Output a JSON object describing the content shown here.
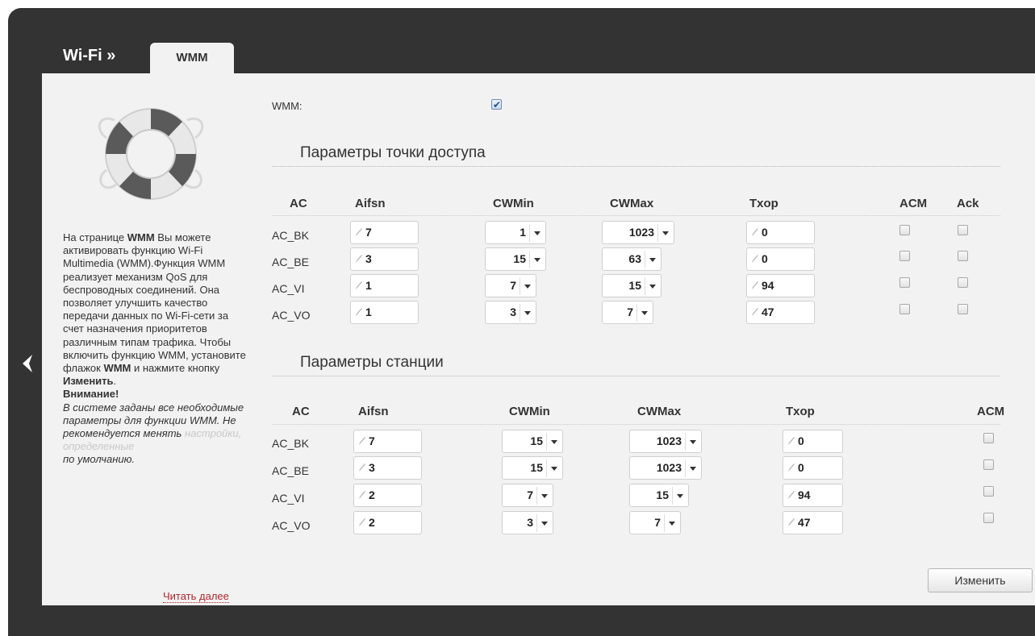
{
  "breadcrumb": {
    "root": "Wi-Fi »",
    "tab": "WMM"
  },
  "help": {
    "p1_a": "На странице ",
    "p1_b": "WMM",
    "p1_c": " Вы можете активировать функцию Wi-Fi Multimedia (WMM).Функция WMM реализует механизм QoS для беспроводных соединений. Она позволяет улучшить качество передачи данных по Wi-Fi-сети за счет назначения приоритетов различным типам трафика. Чтобы включить функцию WMM, установите флажок ",
    "p1_d": "WMM",
    "p1_e": " и нажмите кнопку ",
    "p1_f": "Изменить",
    "p1_g": ".",
    "warn": "Внимание!",
    "italic": "В системе заданы все необходимые параметры для функции WMM. Не рекомендуется менять ",
    "faded": "настройки, определенные",
    "tail": "по умолчанию.",
    "more": "Читать далее"
  },
  "wmm": {
    "label": "WMM:",
    "checked": true
  },
  "ap": {
    "title": "Параметры точки доступа",
    "headers": {
      "ac": "AC",
      "aifsn": "Aifsn",
      "cwmin": "CWMin",
      "cwmax": "CWMax",
      "txop": "Txop",
      "acm": "ACM",
      "ack": "Ack"
    },
    "rows": [
      {
        "ac": "AC_BK",
        "aifsn": "7",
        "cwmin": "1",
        "cwmax": "1023",
        "txop": "0",
        "acm": false,
        "ack": false
      },
      {
        "ac": "AC_BE",
        "aifsn": "3",
        "cwmin": "15",
        "cwmax": "63",
        "txop": "0",
        "acm": false,
        "ack": false
      },
      {
        "ac": "AC_VI",
        "aifsn": "1",
        "cwmin": "7",
        "cwmax": "15",
        "txop": "94",
        "acm": false,
        "ack": false
      },
      {
        "ac": "AC_VO",
        "aifsn": "1",
        "cwmin": "3",
        "cwmax": "7",
        "txop": "47",
        "acm": false,
        "ack": false
      }
    ]
  },
  "sta": {
    "title": "Параметры станции",
    "headers": {
      "ac": "AC",
      "aifsn": "Aifsn",
      "cwmin": "CWMin",
      "cwmax": "CWMax",
      "txop": "Txop",
      "acm": "ACM"
    },
    "rows": [
      {
        "ac": "AC_BK",
        "aifsn": "7",
        "cwmin": "15",
        "cwmax": "1023",
        "txop": "0",
        "acm": false
      },
      {
        "ac": "AC_BE",
        "aifsn": "3",
        "cwmin": "15",
        "cwmax": "1023",
        "txop": "0",
        "acm": false
      },
      {
        "ac": "AC_VI",
        "aifsn": "2",
        "cwmin": "7",
        "cwmax": "15",
        "txop": "94",
        "acm": false
      },
      {
        "ac": "AC_VO",
        "aifsn": "2",
        "cwmin": "3",
        "cwmax": "7",
        "txop": "47",
        "acm": false
      }
    ]
  },
  "apply_label": "Изменить"
}
